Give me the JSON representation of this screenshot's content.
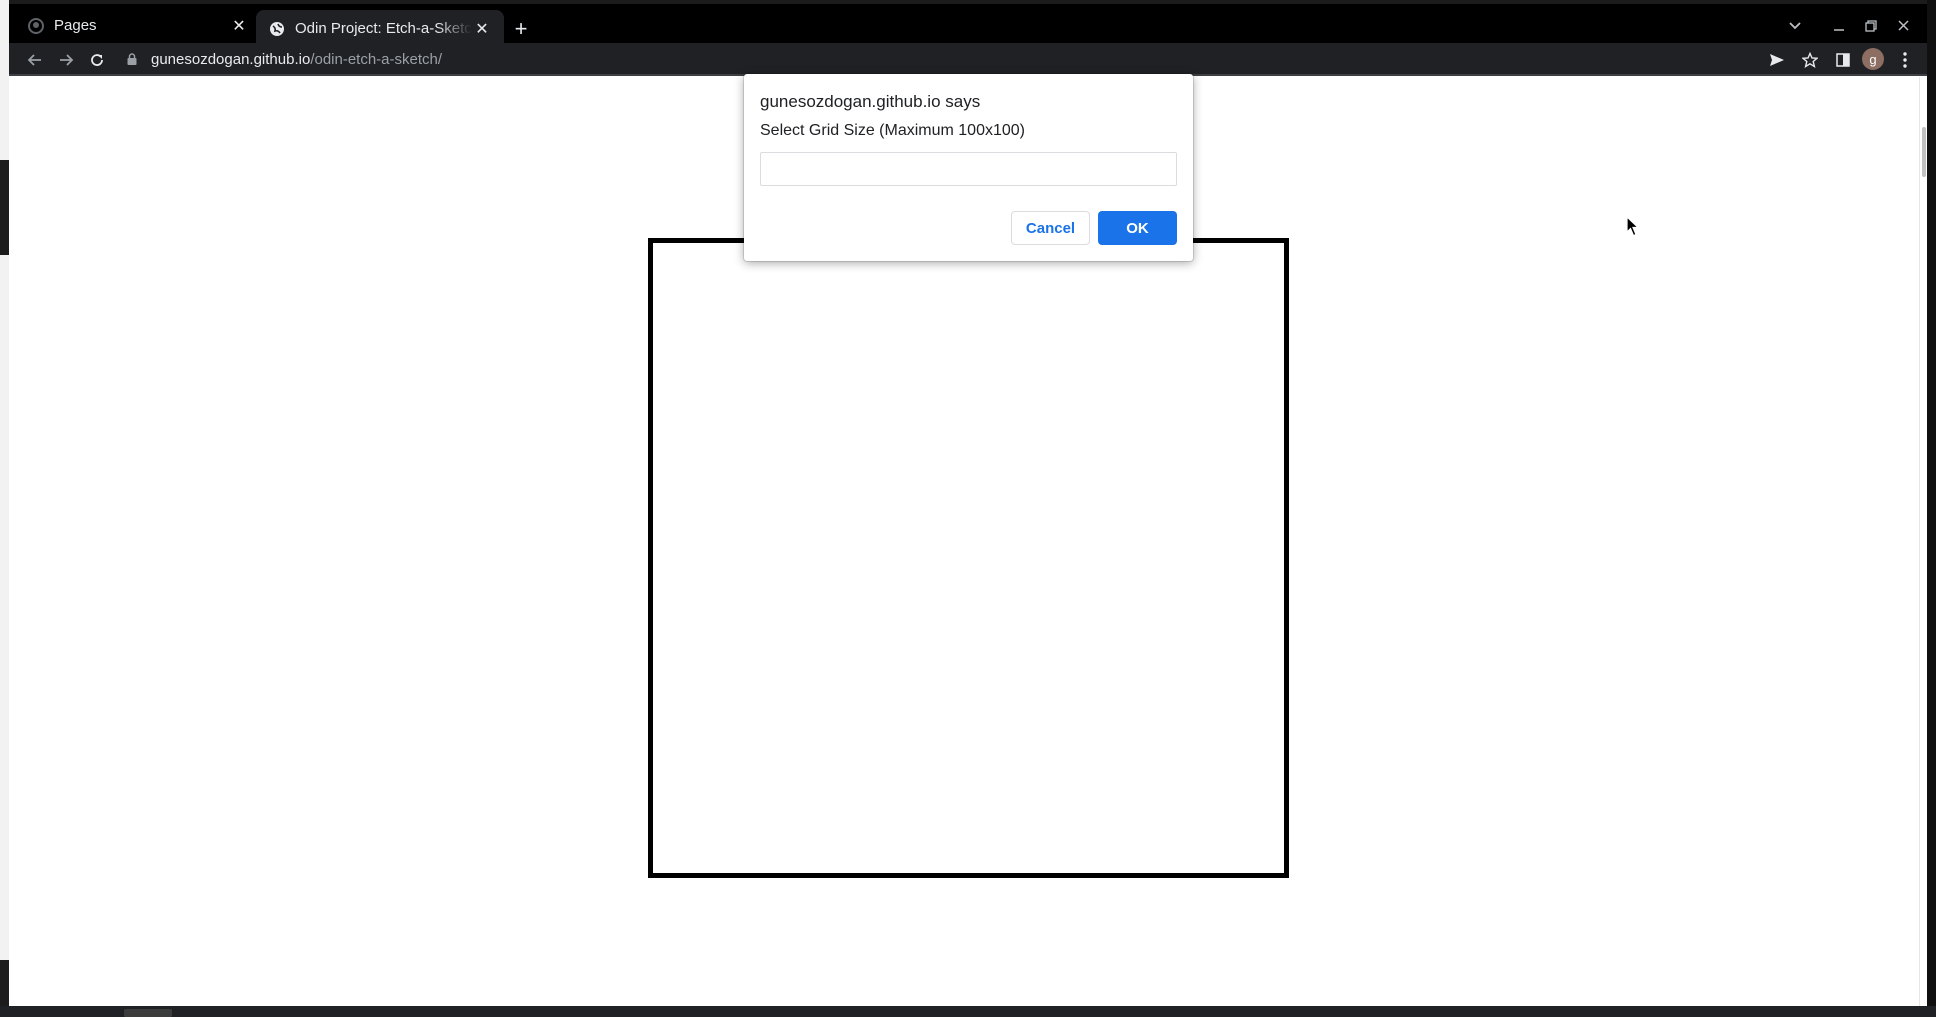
{
  "browser": {
    "tabs": [
      {
        "title": "Pages",
        "active": false,
        "icon": "github-icon"
      },
      {
        "title": "Odin Project: Etch-a-Sketch",
        "active": true,
        "icon": "globe-icon"
      }
    ],
    "url_host": "gunesozdogan.github.io",
    "url_path": "/odin-etch-a-sketch/",
    "profile_initial": "g",
    "colors": {
      "chrome_bg": "#202124",
      "tabstrip_bg": "#000000",
      "accent": "#1a73e8"
    }
  },
  "dialog": {
    "origin": "gunesozdogan.github.io says",
    "message": "Select Grid Size (Maximum 100x100)",
    "input_value": "",
    "cancel_label": "Cancel",
    "ok_label": "OK"
  }
}
